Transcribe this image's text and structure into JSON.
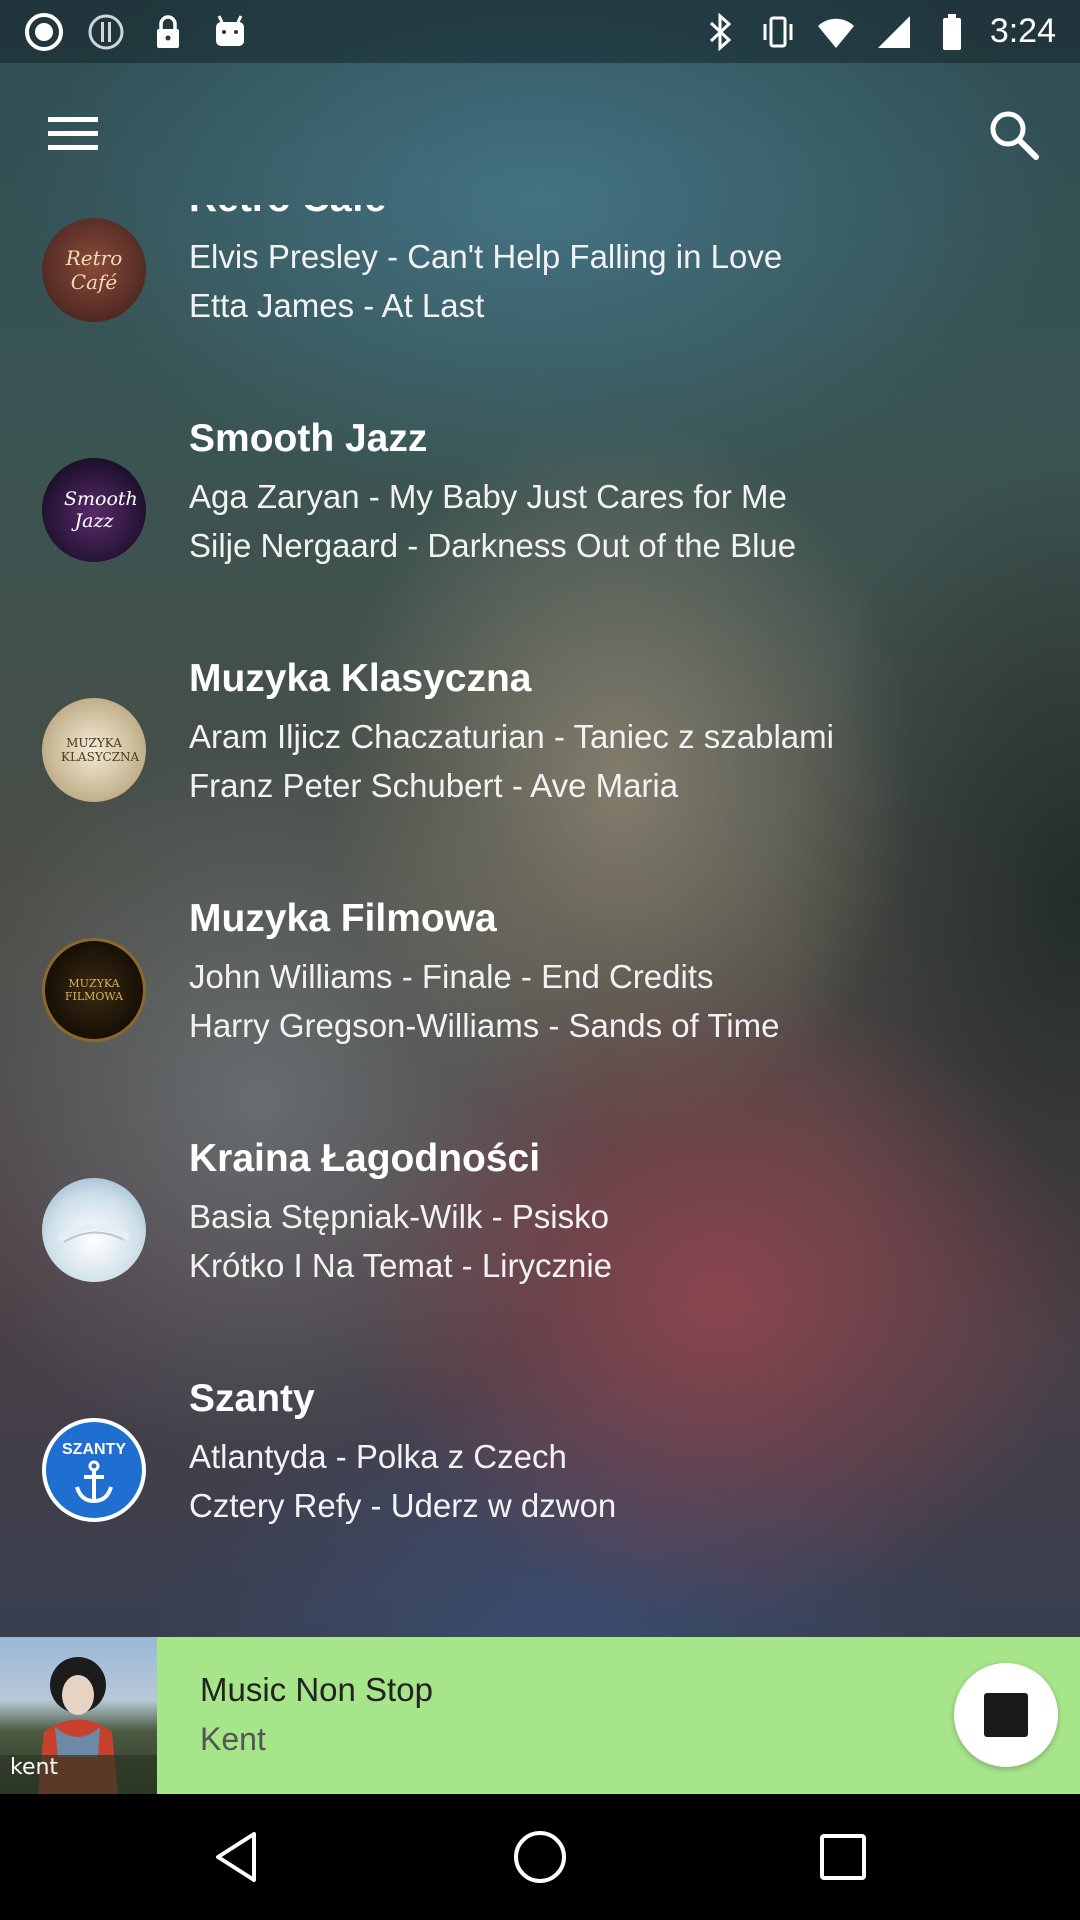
{
  "status_bar": {
    "time": "3:24",
    "left_icons": [
      "record-icon",
      "sync-icon",
      "lock-icon",
      "android-icon"
    ],
    "right_icons": [
      "bluetooth-icon",
      "vibrate-icon",
      "wifi-icon",
      "signal-icon",
      "battery-icon"
    ]
  },
  "toolbar": {
    "menu_icon": "menu-icon",
    "search_icon": "search-icon"
  },
  "stations": [
    {
      "name": "Retro Cafe",
      "logo_text": "Retro Café",
      "tracks": [
        "Elvis Presley - Can't Help Falling in Love",
        "Etta James - At Last"
      ]
    },
    {
      "name": "Smooth Jazz",
      "logo_text": "Smooth Jazz",
      "tracks": [
        "Aga Zaryan - My Baby Just Cares for Me",
        "Silje Nergaard - Darkness Out of the Blue"
      ]
    },
    {
      "name": "Muzyka Klasyczna",
      "logo_text": "MUZYKA KLASYCZNA",
      "tracks": [
        "Aram Iljicz Chaczaturian - Taniec z szablami",
        "Franz Peter Schubert - Ave Maria"
      ]
    },
    {
      "name": "Muzyka Filmowa",
      "logo_text": "MUZYKA FILMOWA",
      "tracks": [
        "John Williams - Finale - End Credits",
        "Harry Gregson-Williams - Sands of Time"
      ]
    },
    {
      "name": "Kraina Łagodności",
      "logo_text": "",
      "tracks": [
        "Basia Stępniak-Wilk - Psisko",
        "Krótko I Na Temat - Lirycznie"
      ]
    },
    {
      "name": "Szanty",
      "logo_text": "SZANTY",
      "tracks": [
        "Atlantyda - Polka z Czech",
        "Cztery Refy - Uderz w dzwon"
      ]
    }
  ],
  "player": {
    "title": "Music Non Stop",
    "artist": "Kent",
    "cover_text": "kent",
    "button_icon": "stop-icon",
    "background_color": "#a6e58a"
  },
  "nav_bar": {
    "buttons": [
      "back-icon",
      "home-icon",
      "recents-icon"
    ]
  }
}
